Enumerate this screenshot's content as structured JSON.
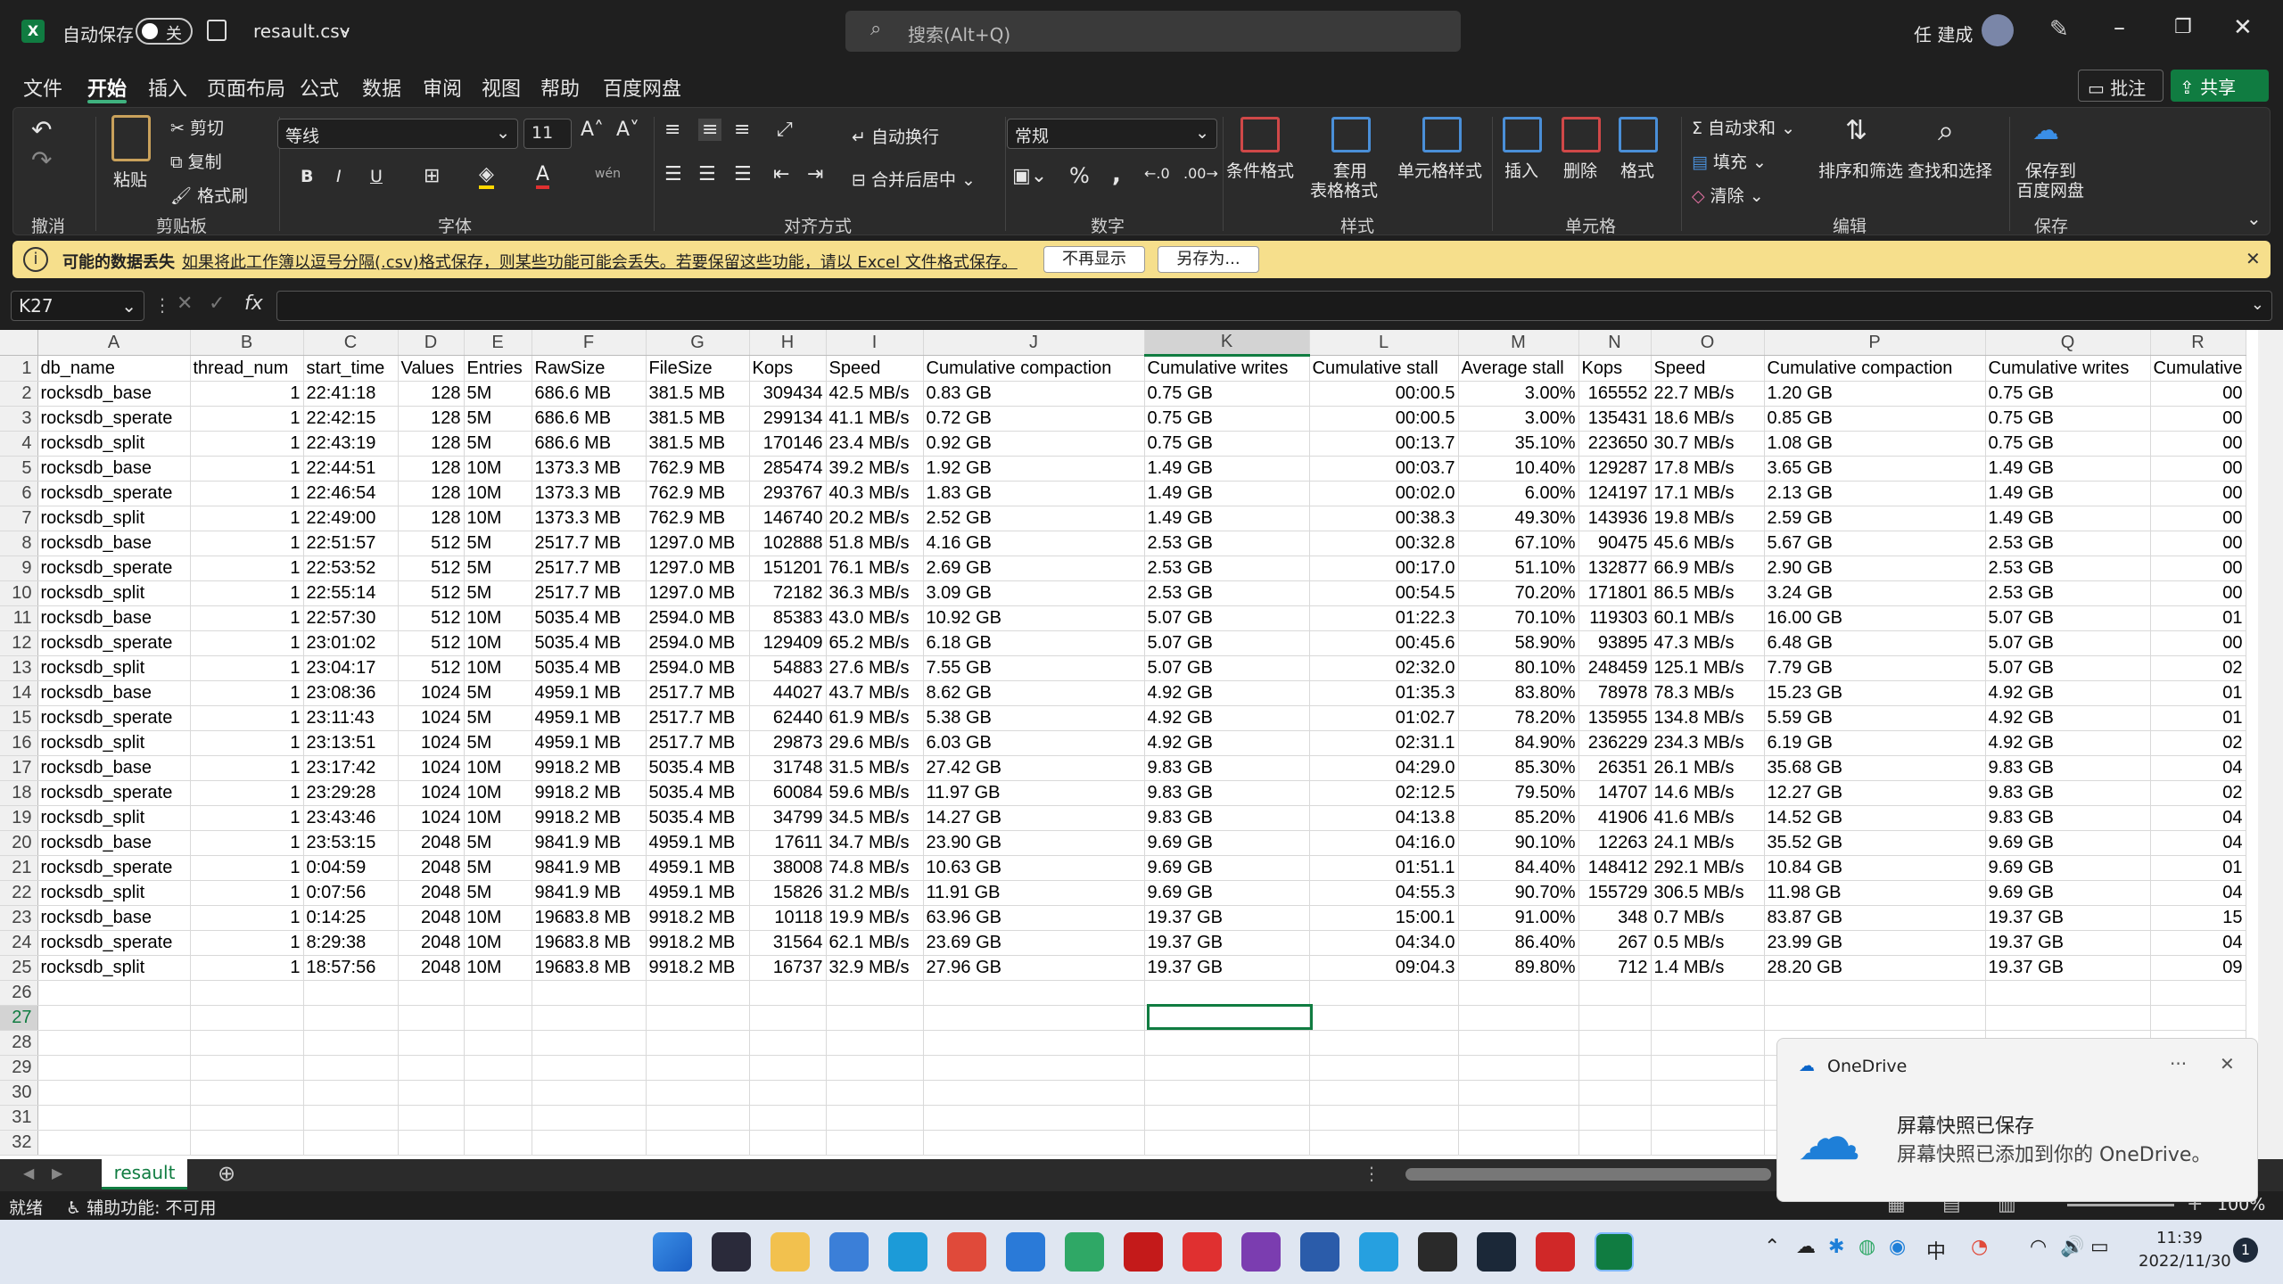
{
  "titlebar": {
    "autosave_label": "自动保存",
    "autosave_state": "关",
    "filename": "resault.csv",
    "search_placeholder": "搜索(Alt+Q)",
    "user_name": "任 建成"
  },
  "menu": {
    "items": [
      "文件",
      "开始",
      "插入",
      "页面布局",
      "公式",
      "数据",
      "审阅",
      "视图",
      "帮助",
      "百度网盘"
    ],
    "active": "开始",
    "comment_label": "批注",
    "share_label": "共享"
  },
  "ribbon": {
    "undo_group": "撤消",
    "clipboard": {
      "paste": "粘贴",
      "cut": "剪切",
      "copy": "复制",
      "format_painter": "格式刷",
      "group": "剪贴板"
    },
    "font": {
      "name": "等线",
      "size": "11",
      "group": "字体",
      "bold": "B",
      "italic": "I",
      "underline": "U"
    },
    "alignment": {
      "wrap": "自动换行",
      "merge": "合并后居中",
      "group": "对齐方式"
    },
    "number": {
      "format": "常规",
      "percent": "%",
      "comma": ",",
      "group": "数字"
    },
    "styles": {
      "conditional": "条件格式",
      "table_line1": "套用",
      "table_line2": "表格格式",
      "cell_styles": "单元格样式",
      "group": "样式"
    },
    "cells": {
      "insert": "插入",
      "delete": "删除",
      "format": "格式",
      "group": "单元格"
    },
    "editing": {
      "autosum": "自动求和",
      "fill": "填充",
      "clear": "清除",
      "sort_filter": "排序和筛选",
      "find_select": "查找和选择",
      "group": "编辑"
    },
    "save": {
      "line1": "保存到",
      "line2": "百度网盘",
      "group": "保存"
    }
  },
  "infobar": {
    "title": "可能的数据丢失",
    "message": "如果将此工作簿以逗号分隔(.csv)格式保存，则某些功能可能会丢失。若要保留这些功能，请以 Excel 文件格式保存。",
    "dont_show": "不再显示",
    "save_as": "另存为..."
  },
  "formula_bar": {
    "name_box": "K27",
    "fx": "fx",
    "content": ""
  },
  "sheet": {
    "columns": [
      "A",
      "B",
      "C",
      "D",
      "E",
      "F",
      "G",
      "H",
      "I",
      "J",
      "K",
      "L",
      "M",
      "N",
      "O",
      "P",
      "Q",
      "R"
    ],
    "rows": [
      [
        "db_name",
        "thread_num",
        "start_time",
        "Values",
        "Entries",
        "RawSize",
        "FileSize",
        "Kops",
        "Speed",
        "Cumulative compaction",
        "Cumulative writes",
        "Cumulative stall",
        "Average stall",
        "Kops",
        "Speed",
        "Cumulative compaction",
        "Cumulative writes",
        "Cumulative"
      ],
      [
        "rocksdb_base",
        "1",
        "22:41:18",
        "128",
        "5M",
        "686.6 MB",
        "381.5 MB",
        "309434",
        "42.5 MB/s",
        "0.83 GB",
        "0.75 GB",
        "00:00.5",
        "3.00%",
        "165552",
        "22.7 MB/s",
        "1.20 GB",
        "0.75 GB",
        "00"
      ],
      [
        "rocksdb_sperate",
        "1",
        "22:42:15",
        "128",
        "5M",
        "686.6 MB",
        "381.5 MB",
        "299134",
        "41.1 MB/s",
        "0.72 GB",
        "0.75 GB",
        "00:00.5",
        "3.00%",
        "135431",
        "18.6 MB/s",
        "0.85 GB",
        "0.75 GB",
        "00"
      ],
      [
        "rocksdb_split",
        "1",
        "22:43:19",
        "128",
        "5M",
        "686.6 MB",
        "381.5 MB",
        "170146",
        "23.4 MB/s",
        "0.92 GB",
        "0.75 GB",
        "00:13.7",
        "35.10%",
        "223650",
        "30.7 MB/s",
        "1.08 GB",
        "0.75 GB",
        "00"
      ],
      [
        "rocksdb_base",
        "1",
        "22:44:51",
        "128",
        "10M",
        "1373.3 MB",
        "762.9 MB",
        "285474",
        "39.2 MB/s",
        "1.92 GB",
        "1.49 GB",
        "00:03.7",
        "10.40%",
        "129287",
        "17.8 MB/s",
        "3.65 GB",
        "1.49 GB",
        "00"
      ],
      [
        "rocksdb_sperate",
        "1",
        "22:46:54",
        "128",
        "10M",
        "1373.3 MB",
        "762.9 MB",
        "293767",
        "40.3 MB/s",
        "1.83 GB",
        "1.49 GB",
        "00:02.0",
        "6.00%",
        "124197",
        "17.1 MB/s",
        "2.13 GB",
        "1.49 GB",
        "00"
      ],
      [
        "rocksdb_split",
        "1",
        "22:49:00",
        "128",
        "10M",
        "1373.3 MB",
        "762.9 MB",
        "146740",
        "20.2 MB/s",
        "2.52 GB",
        "1.49 GB",
        "00:38.3",
        "49.30%",
        "143936",
        "19.8 MB/s",
        "2.59 GB",
        "1.49 GB",
        "00"
      ],
      [
        "rocksdb_base",
        "1",
        "22:51:57",
        "512",
        "5M",
        "2517.7 MB",
        "1297.0 MB",
        "102888",
        "51.8 MB/s",
        "4.16 GB",
        "2.53 GB",
        "00:32.8",
        "67.10%",
        "90475",
        "45.6 MB/s",
        "5.67 GB",
        "2.53 GB",
        "00"
      ],
      [
        "rocksdb_sperate",
        "1",
        "22:53:52",
        "512",
        "5M",
        "2517.7 MB",
        "1297.0 MB",
        "151201",
        "76.1 MB/s",
        "2.69 GB",
        "2.53 GB",
        "00:17.0",
        "51.10%",
        "132877",
        "66.9 MB/s",
        "2.90 GB",
        "2.53 GB",
        "00"
      ],
      [
        "rocksdb_split",
        "1",
        "22:55:14",
        "512",
        "5M",
        "2517.7 MB",
        "1297.0 MB",
        "72182",
        "36.3 MB/s",
        "3.09 GB",
        "2.53 GB",
        "00:54.5",
        "70.20%",
        "171801",
        "86.5 MB/s",
        "3.24 GB",
        "2.53 GB",
        "00"
      ],
      [
        "rocksdb_base",
        "1",
        "22:57:30",
        "512",
        "10M",
        "5035.4 MB",
        "2594.0 MB",
        "85383",
        "43.0 MB/s",
        "10.92 GB",
        "5.07 GB",
        "01:22.3",
        "70.10%",
        "119303",
        "60.1 MB/s",
        "16.00 GB",
        "5.07 GB",
        "01"
      ],
      [
        "rocksdb_sperate",
        "1",
        "23:01:02",
        "512",
        "10M",
        "5035.4 MB",
        "2594.0 MB",
        "129409",
        "65.2 MB/s",
        "6.18 GB",
        "5.07 GB",
        "00:45.6",
        "58.90%",
        "93895",
        "47.3 MB/s",
        "6.48 GB",
        "5.07 GB",
        "00"
      ],
      [
        "rocksdb_split",
        "1",
        "23:04:17",
        "512",
        "10M",
        "5035.4 MB",
        "2594.0 MB",
        "54883",
        "27.6 MB/s",
        "7.55 GB",
        "5.07 GB",
        "02:32.0",
        "80.10%",
        "248459",
        "125.1 MB/s",
        "7.79 GB",
        "5.07 GB",
        "02"
      ],
      [
        "rocksdb_base",
        "1",
        "23:08:36",
        "1024",
        "5M",
        "4959.1 MB",
        "2517.7 MB",
        "44027",
        "43.7 MB/s",
        "8.62 GB",
        "4.92 GB",
        "01:35.3",
        "83.80%",
        "78978",
        "78.3 MB/s",
        "15.23 GB",
        "4.92 GB",
        "01"
      ],
      [
        "rocksdb_sperate",
        "1",
        "23:11:43",
        "1024",
        "5M",
        "4959.1 MB",
        "2517.7 MB",
        "62440",
        "61.9 MB/s",
        "5.38 GB",
        "4.92 GB",
        "01:02.7",
        "78.20%",
        "135955",
        "134.8 MB/s",
        "5.59 GB",
        "4.92 GB",
        "01"
      ],
      [
        "rocksdb_split",
        "1",
        "23:13:51",
        "1024",
        "5M",
        "4959.1 MB",
        "2517.7 MB",
        "29873",
        "29.6 MB/s",
        "6.03 GB",
        "4.92 GB",
        "02:31.1",
        "84.90%",
        "236229",
        "234.3 MB/s",
        "6.19 GB",
        "4.92 GB",
        "02"
      ],
      [
        "rocksdb_base",
        "1",
        "23:17:42",
        "1024",
        "10M",
        "9918.2 MB",
        "5035.4 MB",
        "31748",
        "31.5 MB/s",
        "27.42 GB",
        "9.83 GB",
        "04:29.0",
        "85.30%",
        "26351",
        "26.1 MB/s",
        "35.68 GB",
        "9.83 GB",
        "04"
      ],
      [
        "rocksdb_sperate",
        "1",
        "23:29:28",
        "1024",
        "10M",
        "9918.2 MB",
        "5035.4 MB",
        "60084",
        "59.6 MB/s",
        "11.97 GB",
        "9.83 GB",
        "02:12.5",
        "79.50%",
        "14707",
        "14.6 MB/s",
        "12.27 GB",
        "9.83 GB",
        "02"
      ],
      [
        "rocksdb_split",
        "1",
        "23:43:46",
        "1024",
        "10M",
        "9918.2 MB",
        "5035.4 MB",
        "34799",
        "34.5 MB/s",
        "14.27 GB",
        "9.83 GB",
        "04:13.8",
        "85.20%",
        "41906",
        "41.6 MB/s",
        "14.52 GB",
        "9.83 GB",
        "04"
      ],
      [
        "rocksdb_base",
        "1",
        "23:53:15",
        "2048",
        "5M",
        "9841.9 MB",
        "4959.1 MB",
        "17611",
        "34.7 MB/s",
        "23.90 GB",
        "9.69 GB",
        "04:16.0",
        "90.10%",
        "12263",
        "24.1 MB/s",
        "35.52 GB",
        "9.69 GB",
        "04"
      ],
      [
        "rocksdb_sperate",
        "1",
        "0:04:59",
        "2048",
        "5M",
        "9841.9 MB",
        "4959.1 MB",
        "38008",
        "74.8 MB/s",
        "10.63 GB",
        "9.69 GB",
        "01:51.1",
        "84.40%",
        "148412",
        "292.1 MB/s",
        "10.84 GB",
        "9.69 GB",
        "01"
      ],
      [
        "rocksdb_split",
        "1",
        "0:07:56",
        "2048",
        "5M",
        "9841.9 MB",
        "4959.1 MB",
        "15826",
        "31.2 MB/s",
        "11.91 GB",
        "9.69 GB",
        "04:55.3",
        "90.70%",
        "155729",
        "306.5 MB/s",
        "11.98 GB",
        "9.69 GB",
        "04"
      ],
      [
        "rocksdb_base",
        "1",
        "0:14:25",
        "2048",
        "10M",
        "19683.8 MB",
        "9918.2 MB",
        "10118",
        "19.9 MB/s",
        "63.96 GB",
        "19.37 GB",
        "15:00.1",
        "91.00%",
        "348",
        "0.7 MB/s",
        "83.87 GB",
        "19.37 GB",
        "15"
      ],
      [
        "rocksdb_sperate",
        "1",
        "8:29:38",
        "2048",
        "10M",
        "19683.8 MB",
        "9918.2 MB",
        "31564",
        "62.1 MB/s",
        "23.69 GB",
        "19.37 GB",
        "04:34.0",
        "86.40%",
        "267",
        "0.5 MB/s",
        "23.99 GB",
        "19.37 GB",
        "04"
      ],
      [
        "rocksdb_split",
        "1",
        "18:57:56",
        "2048",
        "10M",
        "19683.8 MB",
        "9918.2 MB",
        "16737",
        "32.9 MB/s",
        "27.96 GB",
        "19.37 GB",
        "09:04.3",
        "89.80%",
        "712",
        "1.4 MB/s",
        "28.20 GB",
        "19.37 GB",
        "09"
      ]
    ],
    "empty_rows": [
      "26",
      "27",
      "28",
      "29",
      "30",
      "31",
      "32"
    ],
    "tab_name": "resault"
  },
  "status": {
    "ready": "就绪",
    "accessibility": "辅助功能: 不可用",
    "zoom": "100%"
  },
  "toast": {
    "app": "OneDrive",
    "title": "屏幕快照已保存",
    "body": "屏幕快照已添加到你的 OneDrive。",
    "more": "···"
  },
  "taskbar": {
    "time": "11:39",
    "date": "2022/11/30",
    "notif_count": "1"
  },
  "colors": {
    "excel_green": "#107c41",
    "ribbon_bg": "#2b2b2b",
    "info_yellow": "#f6df8c",
    "selection": "#107c41"
  }
}
